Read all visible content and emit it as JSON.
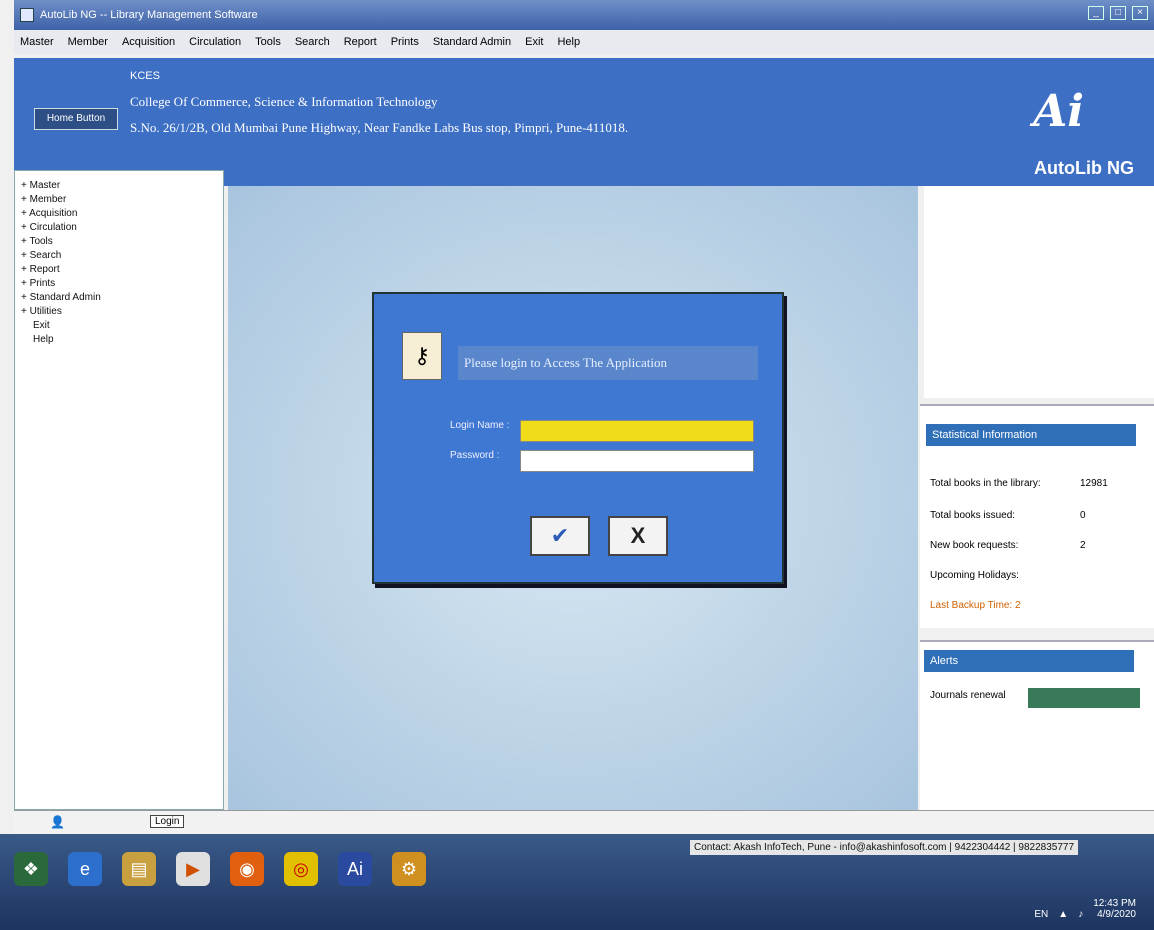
{
  "titlebar": {
    "title": "AutoLib NG -- Library Management Software"
  },
  "menubar": {
    "items": [
      "Master",
      "Member",
      "Acquisition",
      "Circulation",
      "Tools",
      "Search",
      "Report",
      "Prints",
      "Standard Admin",
      "Exit",
      "Help"
    ]
  },
  "header": {
    "home_button": "Home Button",
    "institution_short": "KCES",
    "institution_name": "College Of Commerce, Science & Information Technology",
    "address": "S.No. 26/1/2B, Old Mumbai Pune Highway, Near Fandke Labs Bus stop, Pimpri, Pune-411018.",
    "logo_mark": "Ai",
    "logo_text": "AutoLib NG"
  },
  "sidebar": {
    "items": [
      {
        "label": "+ Master",
        "sub": false
      },
      {
        "label": "+ Member",
        "sub": false
      },
      {
        "label": "+ Acquisition",
        "sub": false
      },
      {
        "label": "+ Circulation",
        "sub": false
      },
      {
        "label": "+ Tools",
        "sub": false
      },
      {
        "label": "+ Search",
        "sub": false
      },
      {
        "label": "+ Report",
        "sub": false
      },
      {
        "label": "+ Prints",
        "sub": false
      },
      {
        "label": "+ Standard Admin",
        "sub": false
      },
      {
        "label": "+ Utilities",
        "sub": false
      },
      {
        "label": "Exit",
        "sub": true
      },
      {
        "label": "Help",
        "sub": true
      }
    ]
  },
  "login": {
    "title": "Please login to Access The Application",
    "login_name_label": "Login Name :",
    "password_label": "Password :",
    "ok_glyph": "✔",
    "cancel_glyph": "X"
  },
  "stats": {
    "header": "Statistical Information",
    "total_books_label": "Total books in the library:",
    "total_books_value": "12981",
    "total_issued_label": "Total books issued:",
    "total_issued_value": "0",
    "new_requests_label": "New book requests:",
    "new_requests_value": "2",
    "holidays_label": "Upcoming Holidays:",
    "backup_label": "Last Backup Time: 2"
  },
  "alerts": {
    "header": "Alerts",
    "item_label": "Journals renewal"
  },
  "statusbar": {
    "login_status": "Login"
  },
  "taskbar": {
    "contact": "Contact: Akash InfoTech, Pune - info@akashinfosoft.com | 9422304442 | 9822835777",
    "lang": "EN",
    "time": "12:43 PM",
    "date": "4/9/2020"
  }
}
